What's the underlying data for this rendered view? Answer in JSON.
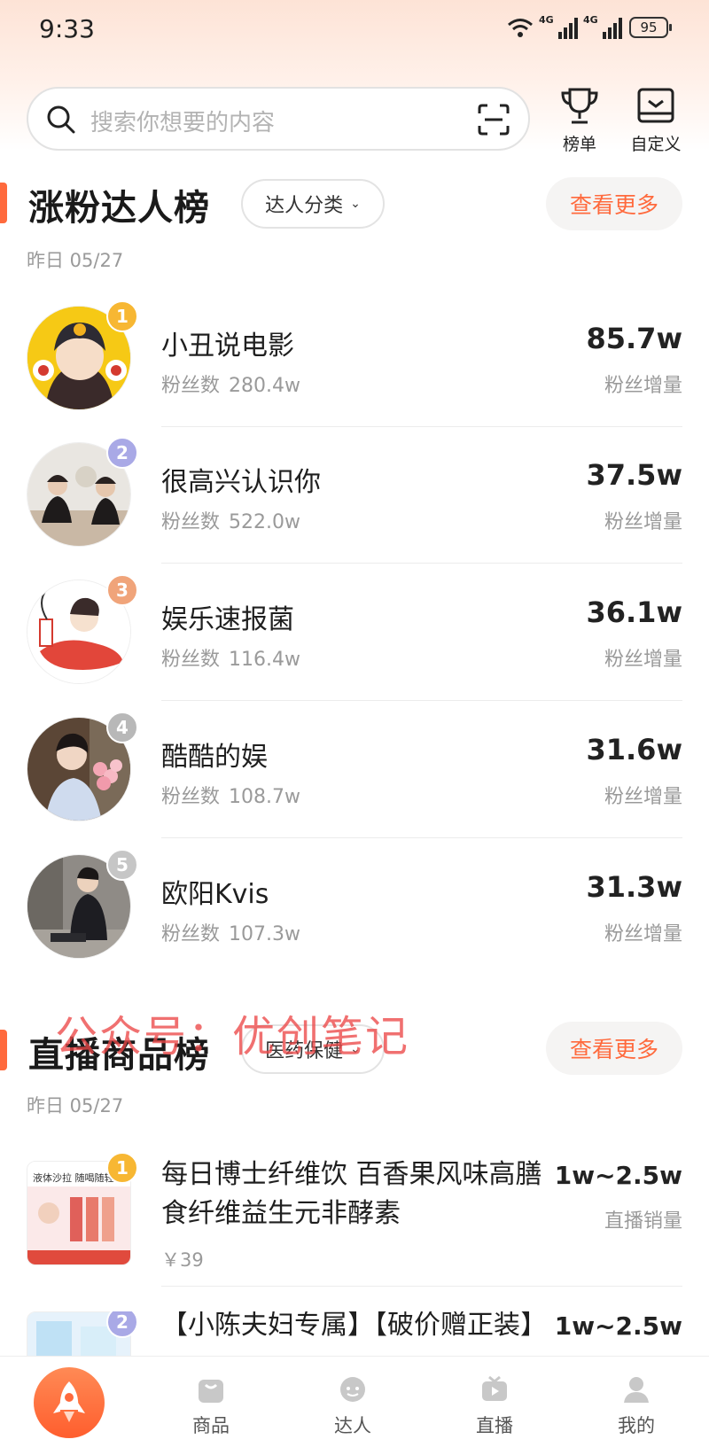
{
  "status_bar": {
    "time": "9:33",
    "network1": "4G",
    "network2": "4G",
    "battery": "95"
  },
  "search": {
    "placeholder": "搜索你想要的内容"
  },
  "top_actions": {
    "ranking_label": "榜单",
    "custom_label": "自定义"
  },
  "influencer_section": {
    "title": "涨粉达人榜",
    "filter_label": "达人分类",
    "more_label": "查看更多",
    "date": "昨日 05/27",
    "rows": [
      {
        "rank": "1",
        "name": "小丑说电影",
        "fans_label": "粉丝数",
        "fans": "280.4w",
        "value": "85.7w",
        "value_label": "粉丝增量"
      },
      {
        "rank": "2",
        "name": "很高兴认识你",
        "fans_label": "粉丝数",
        "fans": "522.0w",
        "value": "37.5w",
        "value_label": "粉丝增量"
      },
      {
        "rank": "3",
        "name": "娱乐速报菌",
        "fans_label": "粉丝数",
        "fans": "116.4w",
        "value": "36.1w",
        "value_label": "粉丝增量"
      },
      {
        "rank": "4",
        "name": "酷酷的娱",
        "fans_label": "粉丝数",
        "fans": "108.7w",
        "value": "31.6w",
        "value_label": "粉丝增量"
      },
      {
        "rank": "5",
        "name": "欧阳Kvis",
        "fans_label": "粉丝数",
        "fans": "107.3w",
        "value": "31.3w",
        "value_label": "粉丝增量"
      }
    ]
  },
  "watermark": "公众号：优创笔记",
  "product_section": {
    "title": "直播商品榜",
    "filter_label": "医药保健",
    "more_label": "查看更多",
    "date": "昨日 05/27",
    "rows": [
      {
        "rank": "1",
        "name": "每日博士纤维饮 百香果风味高膳食纤维益生元非酵素",
        "price": "￥39",
        "value": "1w~2.5w",
        "value_label": "直播销量",
        "img_text": "液体沙拉 随喝随轻"
      },
      {
        "rank": "2",
        "name": "【小陈夫妇专属】【破价赠正装】",
        "price": "",
        "value": "1w~2.5w",
        "value_label": "",
        "img_text": ""
      }
    ]
  },
  "bottom_nav": {
    "products": "商品",
    "influencers": "达人",
    "live": "直播",
    "mine": "我的"
  },
  "colors": {
    "accent": "#ff6a3d",
    "rank1": "#f7b733",
    "rank2": "#a9a9e6",
    "rank3": "#f0a47a",
    "rank4": "#b8b8b8",
    "rank5": "#c6c6c6"
  }
}
